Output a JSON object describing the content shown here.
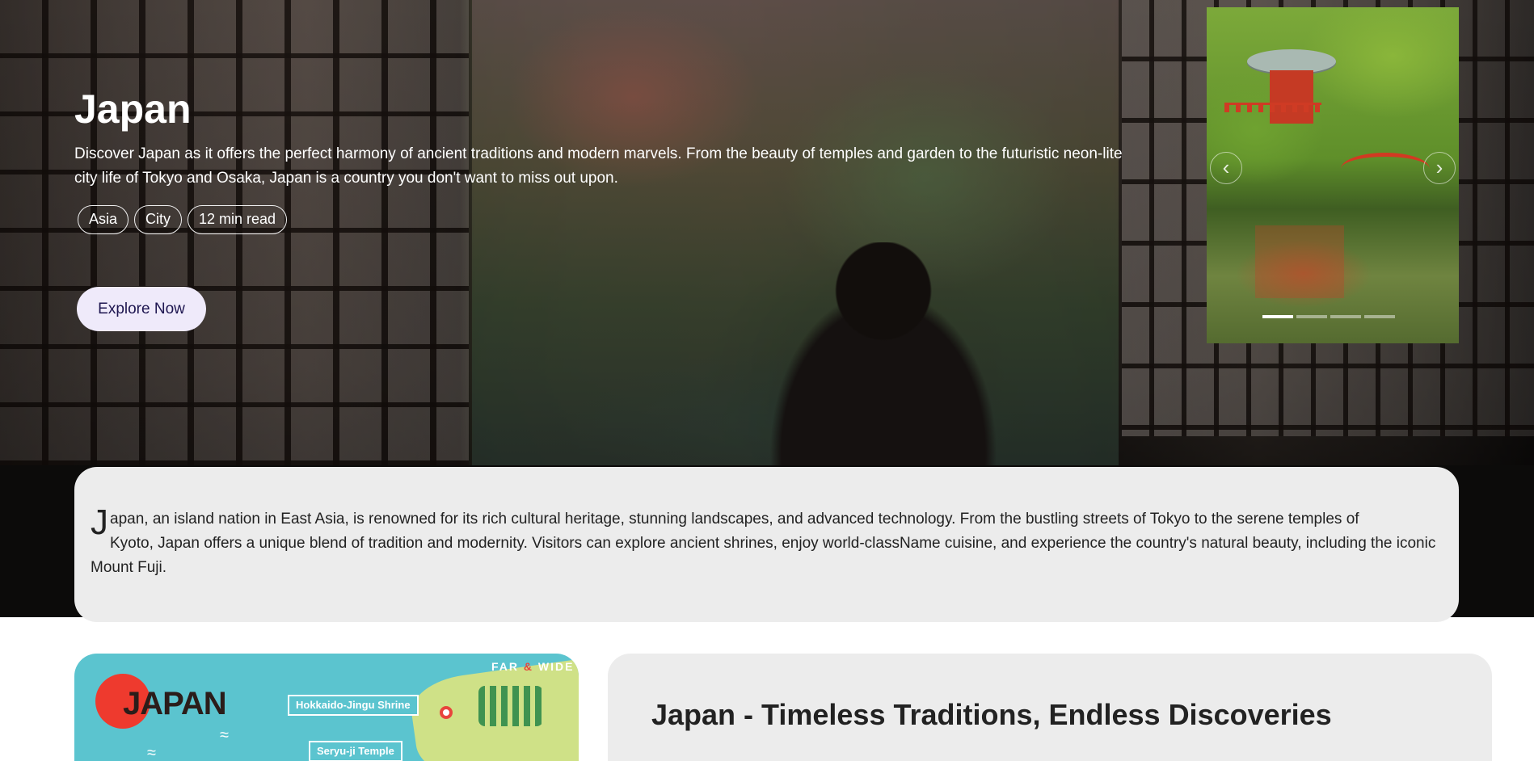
{
  "hero": {
    "title": "Japan",
    "description": "Discover Japan as it offers the perfect harmony of ancient traditions and modern marvels. From the beauty of temples and garden to the futuristic neon-lite city life of Tokyo and Osaka, Japan is a country you don't want to miss out upon.",
    "tags": [
      "Asia",
      "City",
      "12 min read"
    ],
    "cta_label": "Explore Now"
  },
  "carousel": {
    "prev_icon": "chevron-left-icon",
    "next_icon": "chevron-right-icon",
    "slide_count": 4,
    "active_index": 0
  },
  "intro": {
    "drop_cap": "J",
    "line1": "apan, an island nation in East Asia, is renowned for its rich cultural heritage, stunning landscapes, and advanced technology. From the bustling streets of Tokyo to the serene temples of",
    "rest": "Kyoto, Japan offers a unique blend of tradition and modernity. Visitors can explore ancient shrines, enjoy world-className cuisine, and experience the country's natural beauty, including the iconic Mount Fuji."
  },
  "map": {
    "title": "JAPAN",
    "brand_far": "FAR",
    "brand_amp": "&",
    "brand_wide": "WIDE",
    "labels": [
      "Hokkaido-Jingu Shrine",
      "Seryu-ji Temple"
    ]
  },
  "headline": {
    "text": "Japan - Timeless Traditions, Endless Discoveries"
  },
  "colors": {
    "cta_bg": "#efeafa",
    "card_bg": "#ececec",
    "map_bg": "#5bc4cf",
    "map_accent": "#ee3a2e"
  }
}
